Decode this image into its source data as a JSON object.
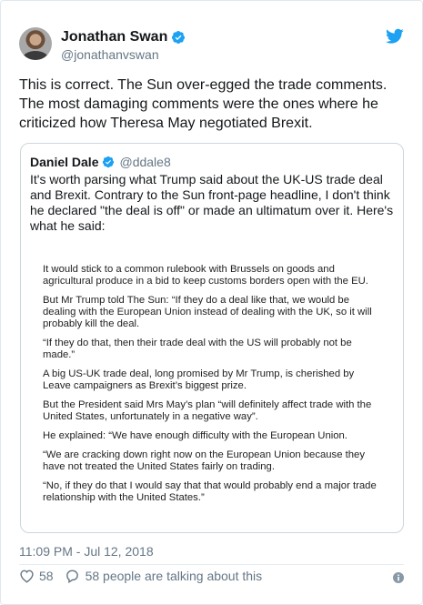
{
  "author": {
    "name": "Jonathan Swan",
    "handle": "@jonathanvswan"
  },
  "tweet_text": "This is correct. The Sun over-egged the trade comments. The most damaging comments were the ones where he criticized how Theresa May negotiated Brexit.",
  "quoted": {
    "name": "Daniel Dale",
    "handle": "@ddale8",
    "text": "It's worth parsing what Trump said about the UK-US trade deal and Brexit. Contrary to the Sun front-page headline, I don't think he declared \"the deal is off\" or made an ultimatum over it. Here's what he said:",
    "article_paragraphs": [
      "It would stick to a common rulebook with Brussels on goods and agricultural produce in a bid to keep customs borders open with the EU.",
      "But Mr Trump told The Sun: “If they do a deal like that, we would be dealing with the European Union instead of dealing with the UK, so it will probably kill the deal.",
      "“If they do that, then their trade deal with the US will probably not be made.”",
      "A big US-UK trade deal, long promised by Mr Trump, is cherished by Leave campaigners as Brexit’s biggest prize.",
      "But the President said Mrs May’s plan “will definitely affect trade with the United States, unfortunately in a negative way”.",
      "He explained: “We have enough difficulty with the European Union.",
      "“We are cracking down right now on the European Union because they have not treated the United States fairly on trading.",
      "“No, if they do that I would say that that would probably end a major trade relationship with the United States.”"
    ]
  },
  "timestamp": "11:09 PM - Jul 12, 2018",
  "likes": "58",
  "talking": "58 people are talking about this",
  "colors": {
    "twitter_blue": "#1da1f2",
    "verified_blue": "#1da1f2",
    "secondary_text": "#657786",
    "border": "#e1e8ed"
  },
  "icons": [
    "verified-badge-icon",
    "twitter-bird-icon",
    "heart-icon",
    "reply-bubble-icon",
    "info-icon"
  ]
}
